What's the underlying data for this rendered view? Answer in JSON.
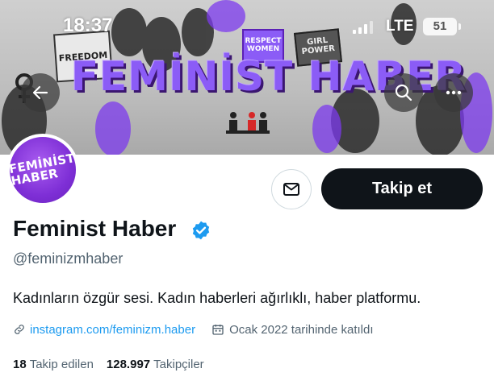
{
  "status_bar": {
    "time": "18:37",
    "network": "LTE",
    "battery": "51"
  },
  "banner": {
    "title": "FEMİNİST HABER",
    "signs": [
      "FREEDOM",
      "RESPECT WOMEN",
      "GIRL POWER"
    ],
    "accent_color": "#8b5cf6"
  },
  "profile": {
    "avatar_text_line1": "FEMİNİST",
    "avatar_text_line2": "HABER",
    "display_name": "Feminist Haber",
    "handle": "@feminizmhaber",
    "bio": "Kadınların özgür sesi. Kadın haberleri ağırlıklı, haber platformu.",
    "link": "instagram.com/feminizm.haber",
    "joined": "Ocak 2022 tarihinde katıldı",
    "verified_color": "#1d9bf0"
  },
  "actions": {
    "follow_label": "Takip et",
    "message_icon": "mail-icon"
  },
  "stats": {
    "following_count": "18",
    "following_label": "Takip edilen",
    "followers_count": "128.997",
    "followers_label": "Takipçiler"
  },
  "icons": {
    "back": "back-arrow-icon",
    "search": "search-icon",
    "more": "more-icon",
    "link": "link-icon",
    "calendar": "calendar-icon"
  }
}
